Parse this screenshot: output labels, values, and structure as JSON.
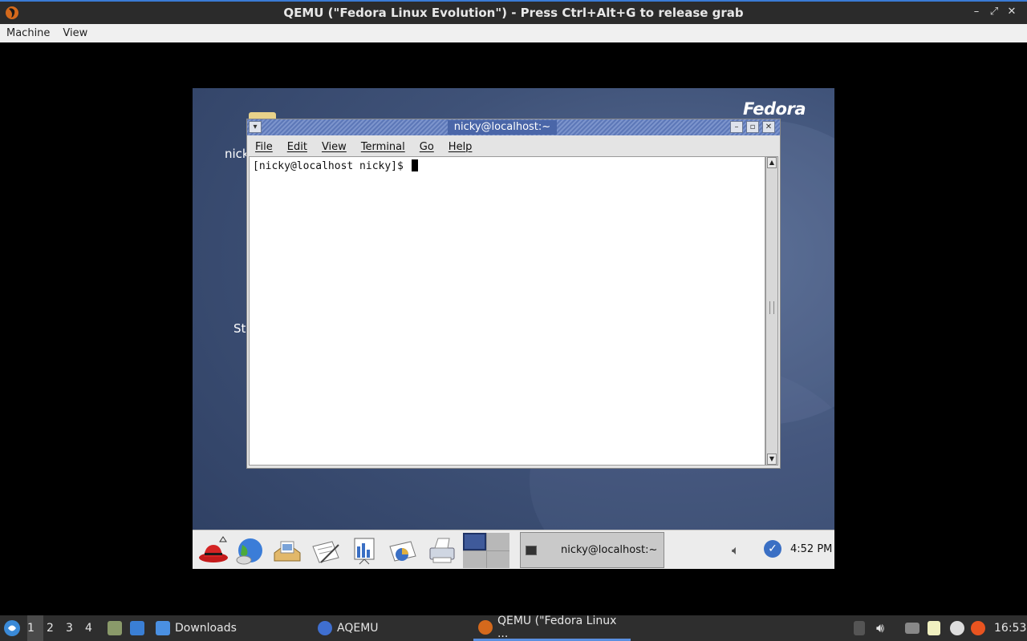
{
  "host": {
    "window_title": "QEMU (\"Fedora Linux Evolution\") - Press Ctrl+Alt+G to release grab",
    "menu": [
      "Machine",
      "View"
    ],
    "window_buttons": [
      "–",
      "⤢",
      "✕"
    ]
  },
  "guest": {
    "logo_text": "Fedora",
    "desktop_labels": [
      "nick",
      "St"
    ],
    "terminal": {
      "title": "nicky@localhost:~",
      "menu": [
        "File",
        "Edit",
        "View",
        "Terminal",
        "Go",
        "Help"
      ],
      "prompt": "[nicky@localhost nicky]$ "
    },
    "panel": {
      "task_label": "nicky@localhost:~",
      "clock": "4:52 PM",
      "launchers": [
        "redhat-menu-icon",
        "web-browser-icon",
        "email-icon",
        "writer-icon",
        "presentation-icon",
        "spreadsheet-icon",
        "print-manager-icon"
      ]
    }
  },
  "host_taskbar": {
    "workspaces": [
      "1",
      "2",
      "3",
      "4"
    ],
    "active_workspace": "1",
    "tasks": [
      {
        "label": "Downloads"
      },
      {
        "label": "AQEMU"
      },
      {
        "label": "QEMU (\"Fedora Linux ..."
      }
    ],
    "clock": "16:53"
  }
}
